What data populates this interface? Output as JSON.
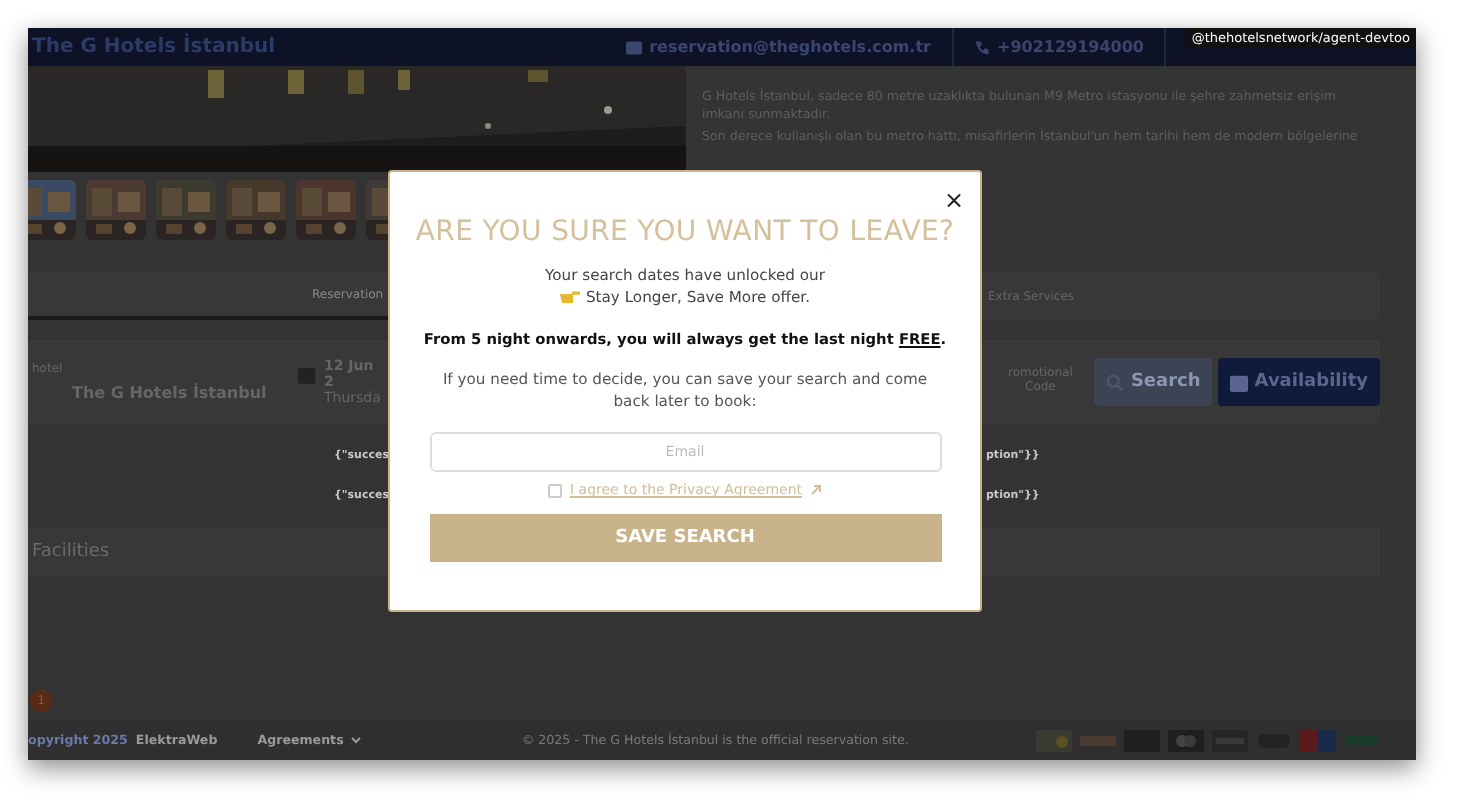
{
  "header": {
    "brand": "The G Hotels İstanbul",
    "email": "reservation@theghotels.com.tr",
    "phone": "+902129194000",
    "overlay_tag": "@thehotelsnetwork/agent-devtoo"
  },
  "description": [
    "G Hotels İstanbul, sadece 80 metre uzaklıkta bulunan M9 Metro istasyonu ile şehre zahmetsiz erişim imkanı sunmaktadır.",
    "Son derece kullanışlı olan bu metro hattı, misafirlerin İstanbul'un hem tarihi hem de modern bölgelerine"
  ],
  "tabs": [
    {
      "label": "Reservation",
      "selected": true
    },
    {
      "label": "Extra Services",
      "selected": false
    }
  ],
  "search_form": {
    "hotel_label": "hotel",
    "hotel": "The G Hotels İstanbul",
    "date": "12 Jun 2",
    "day": "Thursda",
    "promo_label": "romotional Code",
    "search_button": "Search",
    "availability_button": "Availability"
  },
  "results": [
    {
      "left": "{\"succes",
      "right": "ption\"}}"
    },
    {
      "left": "{\"succes",
      "right": "ption\"}}"
    }
  ],
  "section": "Facilities",
  "footer": {
    "badge": "1",
    "copyright": "opyright 2025",
    "brand": "ElektraWeb",
    "agreements": "Agreements",
    "notice": "© 2025 - The G Hotels İstanbul is the official reservation site."
  },
  "modal": {
    "title": "ARE YOU SURE YOU WANT TO LEAVE?",
    "intro": "Your search dates have unlocked our",
    "offer": "Stay Longer, Save More offer.",
    "highlight_before": "From 5 night onwards, you will always get the last night ",
    "highlight_link": "FREE",
    "highlight_after": ".",
    "note": "If you need time to decide, you can save your search and come back later to book:",
    "email_placeholder": "Email",
    "consent": {
      "label": "I agree to the Privacy Agreement",
      "checked": false
    },
    "button": "SAVE SEARCH",
    "close": "×"
  }
}
